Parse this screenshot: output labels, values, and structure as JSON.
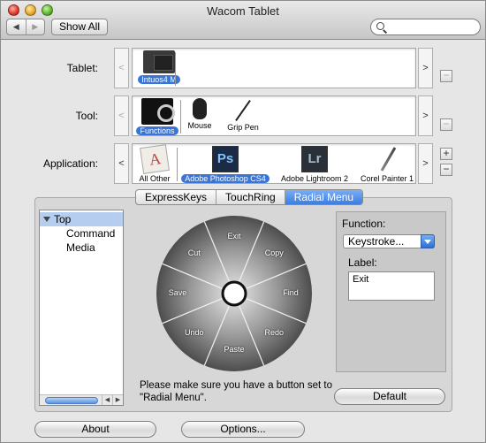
{
  "window": {
    "title": "Wacom Tablet"
  },
  "toolbar": {
    "back_label": "◀",
    "forward_label": "▶",
    "show_all_label": "Show All",
    "search_placeholder": ""
  },
  "rows": {
    "tablet": {
      "label": "Tablet:",
      "items": [
        {
          "label": "Intuos4 M",
          "selected": true
        }
      ]
    },
    "tool": {
      "label": "Tool:",
      "items": [
        {
          "label": "Functions",
          "selected": true
        },
        {
          "label": "Mouse"
        },
        {
          "label": "Grip Pen"
        }
      ]
    },
    "application": {
      "label": "Application:",
      "items": [
        {
          "label": "All Other"
        },
        {
          "label": "Adobe Photoshop CS4",
          "selected": true,
          "icon_text": "Ps"
        },
        {
          "label": "Adobe Lightroom 2",
          "icon_text": "Lr"
        },
        {
          "label": "Corel Painter 1"
        }
      ]
    }
  },
  "arrows": {
    "left": "<",
    "right": ">"
  },
  "buttons_small": {
    "minus": "−",
    "plus": "+"
  },
  "tabs": [
    {
      "label": "ExpressKeys"
    },
    {
      "label": "TouchRing"
    },
    {
      "label": "Radial Menu",
      "active": true
    }
  ],
  "tree": {
    "items": [
      {
        "label": "Top",
        "selected": true
      },
      {
        "label": "Command"
      },
      {
        "label": "Media"
      }
    ],
    "scroll_left": "◀",
    "scroll_right": "▶"
  },
  "radial": {
    "labels": [
      "Exit",
      "Copy",
      "Find",
      "Redo",
      "Paste",
      "Undo",
      "Save",
      "Cut"
    ]
  },
  "note": "Please make sure you have a button set to \"Radial Menu\".",
  "function": {
    "function_label": "Function:",
    "function_value": "Keystroke...",
    "label_label": "Label:",
    "label_value": "Exit"
  },
  "footer": {
    "default_label": "Default",
    "about_label": "About",
    "options_label": "Options..."
  },
  "colors": {
    "selection": "#3875d7",
    "active_tab": "#3b7de3"
  }
}
